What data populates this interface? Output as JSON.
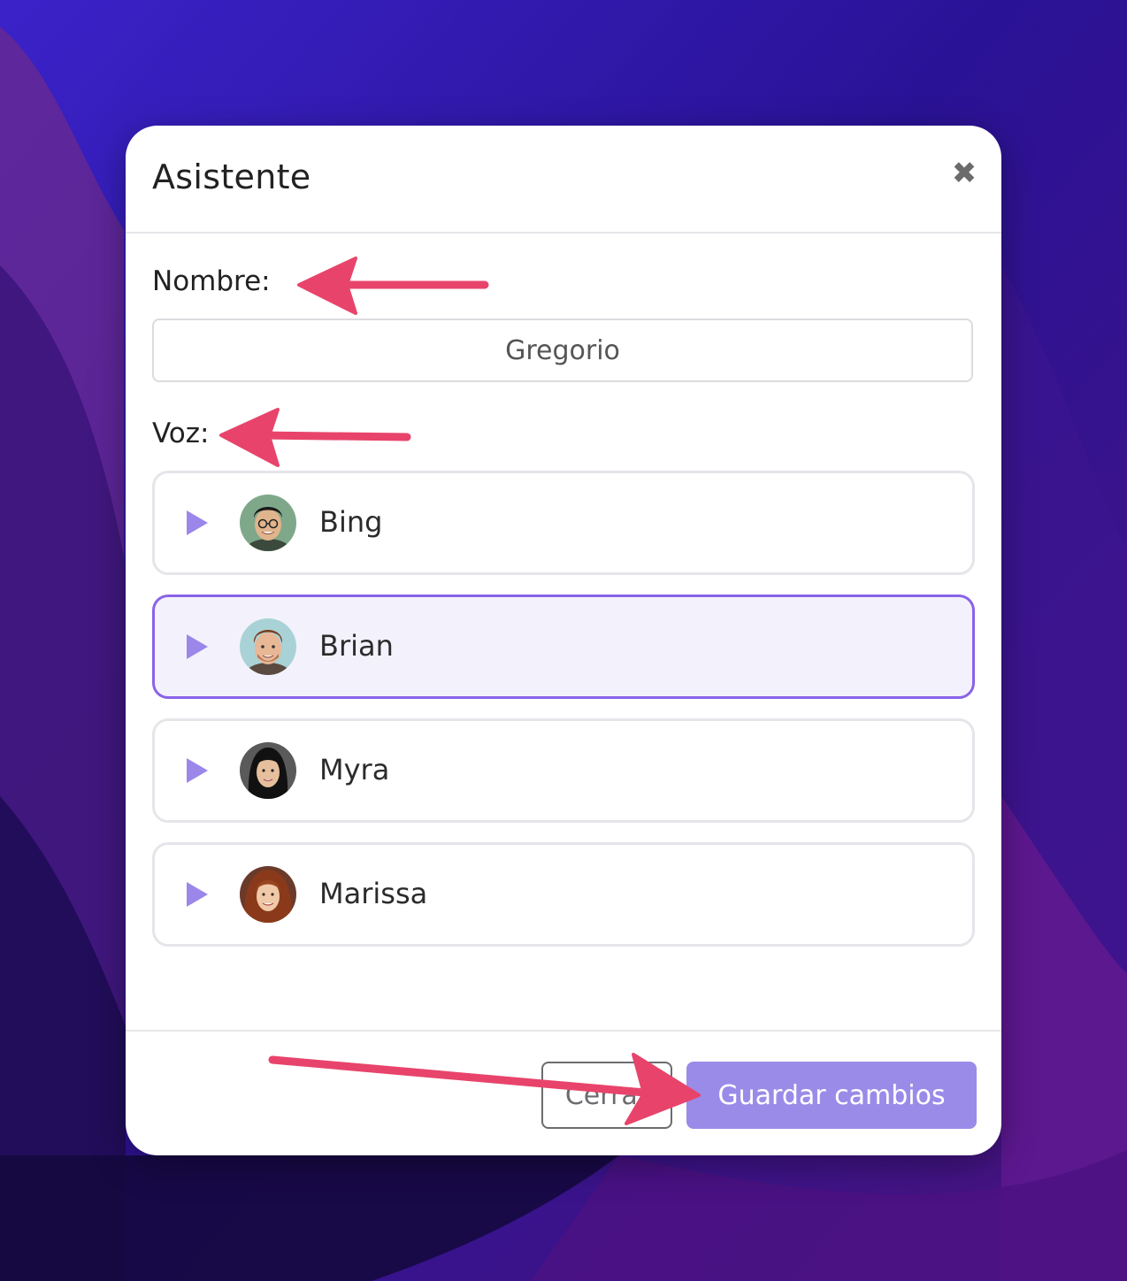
{
  "dialog": {
    "title": "Asistente",
    "close_icon": "close-icon"
  },
  "form": {
    "name_label": "Nombre:",
    "name_value": "Gregorio",
    "voice_label": "Voz:"
  },
  "voices": [
    {
      "name": "Bing",
      "selected": false,
      "icon": "play-icon"
    },
    {
      "name": "Brian",
      "selected": true,
      "icon": "play-icon"
    },
    {
      "name": "Myra",
      "selected": false,
      "icon": "play-icon"
    },
    {
      "name": "Marissa",
      "selected": false,
      "icon": "play-icon"
    }
  ],
  "footer": {
    "cancel_label": "Cerrar",
    "save_label": "Guardar cambios"
  },
  "colors": {
    "accent": "#9b8be8",
    "selected_border": "#8a63e8",
    "annotation_arrow": "#e8446b",
    "wallpaper_base": "#2a138f"
  }
}
